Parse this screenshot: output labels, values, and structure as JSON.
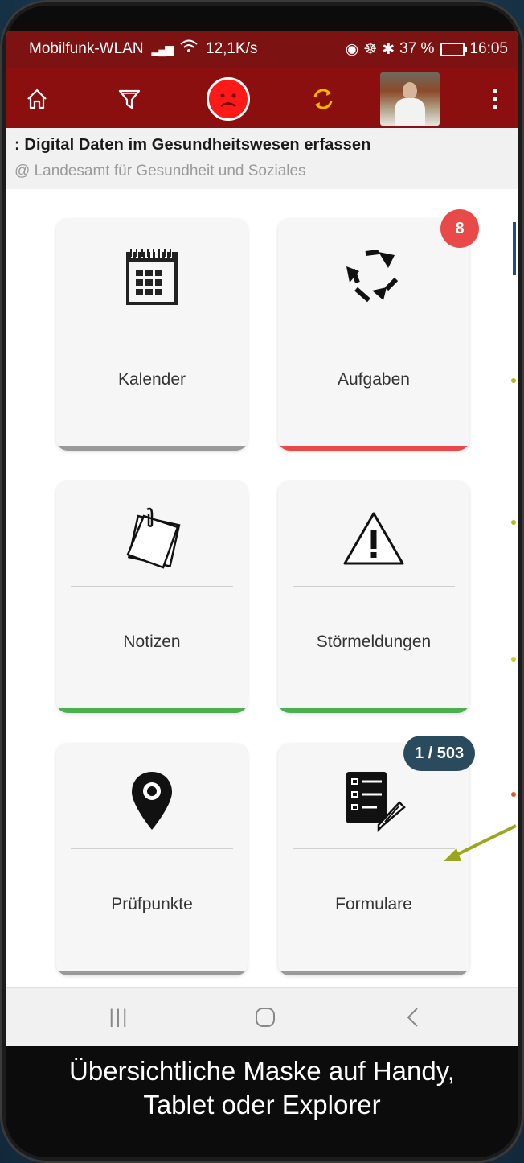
{
  "status": {
    "carrier": "Mobilfunk-WLAN",
    "speed": "12,1K/s",
    "battery": "37 %",
    "time": "16:05"
  },
  "toolbar": {
    "home_icon": "home-icon",
    "filter_icon": "filter-icon",
    "mood_icon": "sad-face-icon",
    "sync_icon": "sync-icon",
    "menu_icon": "more-vert-icon"
  },
  "header": {
    "title": ": Digital Daten im Gesundheitswesen erfassen",
    "subtitle": "@ Landesamt für Gesundheit und Soziales"
  },
  "tiles": [
    {
      "label": "Kalender",
      "icon": "calendar-icon",
      "stripe_color": "#9a9a9a"
    },
    {
      "label": "Aufgaben",
      "icon": "recycle-arrows-icon",
      "stripe_color": "#e84a4a",
      "badge": "8"
    },
    {
      "label": "Notizen",
      "icon": "sticky-notes-icon",
      "stripe_color": "#4caf50"
    },
    {
      "label": "Störmeldungen",
      "icon": "warning-icon",
      "stripe_color": "#4caf50"
    },
    {
      "label": "Prüfpunkte",
      "icon": "map-pin-icon",
      "stripe_color": "#9a9a9a"
    },
    {
      "label": "Formulare",
      "icon": "form-list-icon",
      "stripe_color": "#9a9a9a",
      "badge": "1 / 503"
    }
  ],
  "navbar": {
    "recents": "|||",
    "home": "○",
    "back": "‹"
  },
  "caption": {
    "line1": "Übersichtliche Maske auf Handy,",
    "line2": "Tablet oder Explorer"
  },
  "colors": {
    "brand_red": "#8b0f0f",
    "badge_red": "#e84a4a",
    "badge_dark": "#2a4a5e",
    "green": "#4caf50",
    "arrow": "#9aa61e"
  }
}
